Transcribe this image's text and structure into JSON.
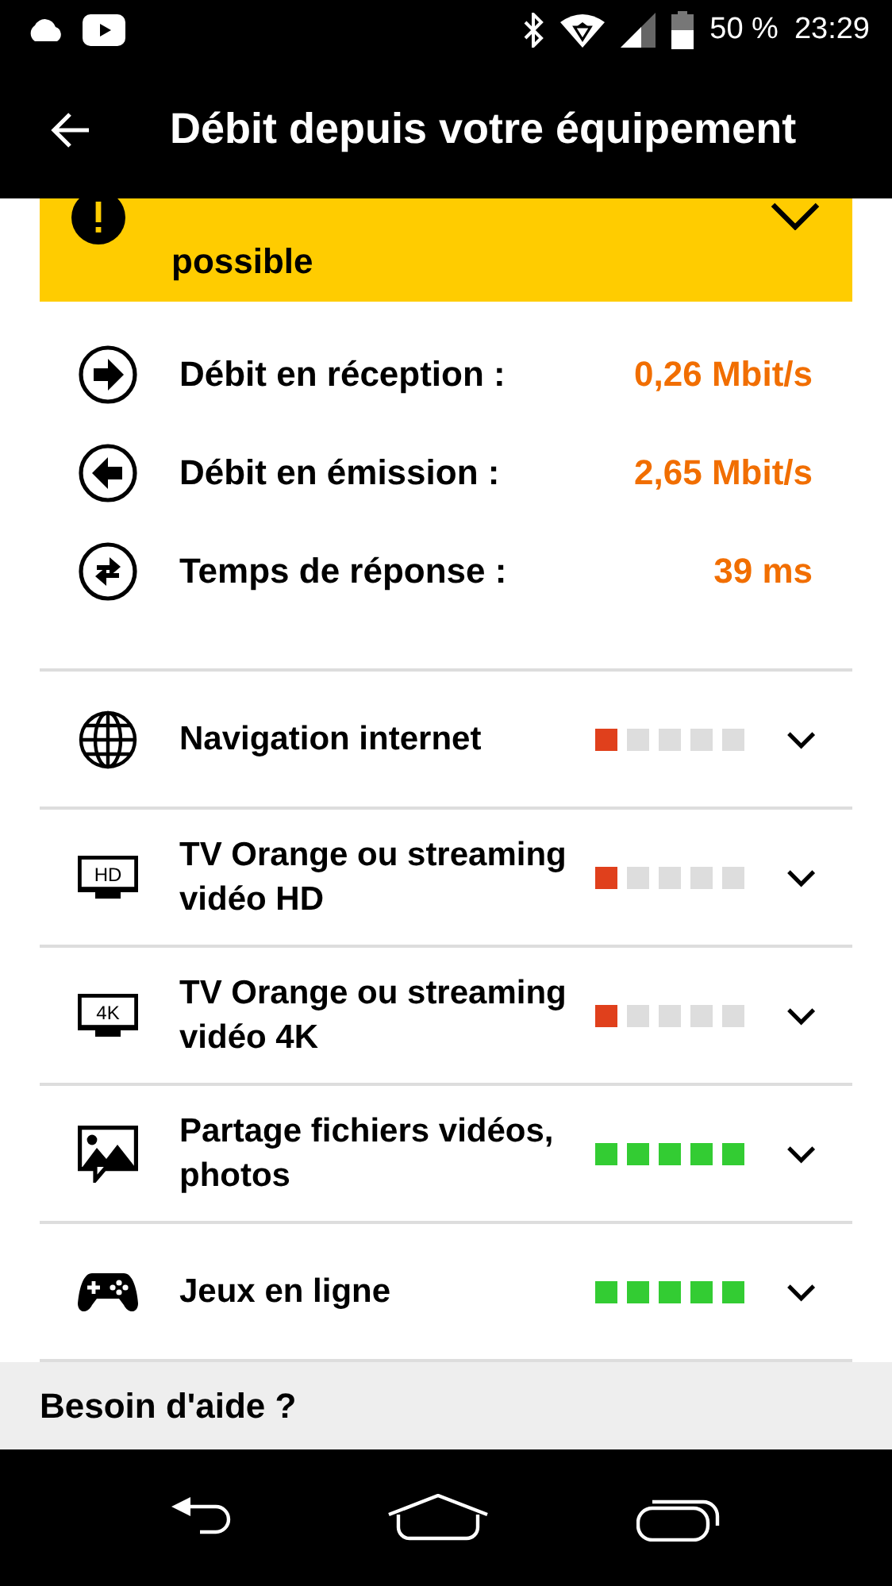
{
  "status_bar": {
    "battery": "50 %",
    "time": "23:29"
  },
  "app_bar": {
    "title": "Débit depuis votre équipement"
  },
  "alert": {
    "text": "possible",
    "expanded": false
  },
  "measures": [
    {
      "kind": "download",
      "label": "Débit en réception :",
      "value": "0,26 Mbit/s"
    },
    {
      "kind": "upload",
      "label": "Débit en émission :",
      "value": "2,65 Mbit/s"
    },
    {
      "kind": "latency",
      "label": "Temps de réponse :",
      "value": "39 ms"
    }
  ],
  "usages": [
    {
      "kind": "web",
      "label": "Navigation internet",
      "stars": 1,
      "color": "#e0401c"
    },
    {
      "kind": "tv",
      "badge": "HD",
      "label": "TV Orange ou streaming vidéo HD",
      "stars": 1,
      "color": "#e0401c"
    },
    {
      "kind": "tv",
      "badge": "4K",
      "label": "TV Orange ou streaming vidéo 4K",
      "stars": 1,
      "color": "#e0401c"
    },
    {
      "kind": "photos",
      "label": "Partage fichiers vidéos, photos",
      "stars": 5,
      "color": "#33cc33"
    },
    {
      "kind": "games",
      "label": "Jeux en ligne",
      "stars": 5,
      "color": "#33cc33"
    }
  ],
  "help": {
    "title": "Besoin d'aide ?"
  }
}
